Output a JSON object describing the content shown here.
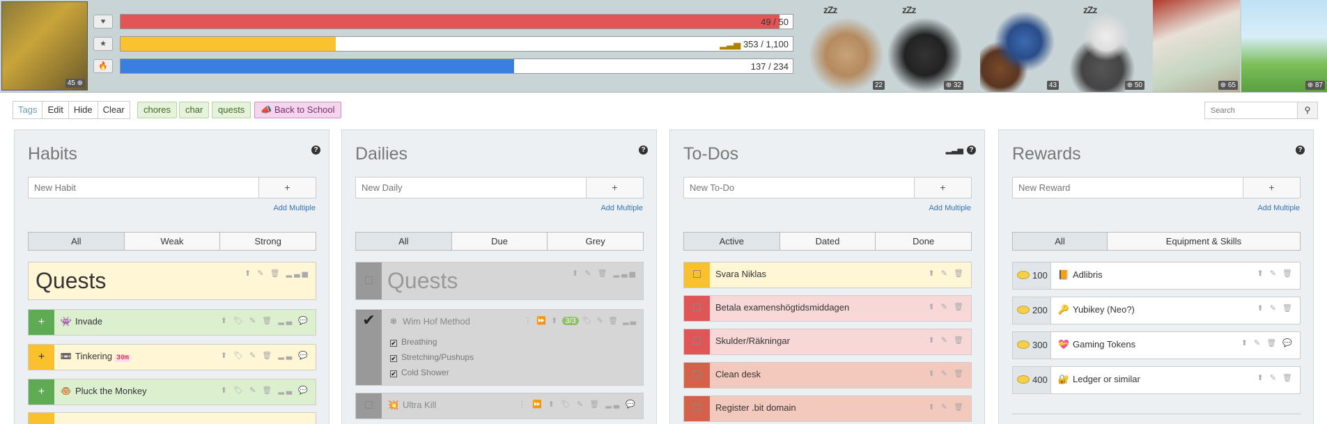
{
  "header": {
    "avatar_level": "45",
    "health": {
      "text": "49 / 50",
      "fraction": 0.98,
      "color": "#e05555"
    },
    "experience": {
      "text": "353 / 1,100",
      "fraction": 0.32,
      "color": "#f9c22e"
    },
    "mana": {
      "text": "137 / 234",
      "fraction": 0.585,
      "color": "#3a7fe0"
    },
    "party": [
      {
        "level": "22"
      },
      {
        "level": "32"
      },
      {
        "level": "43"
      },
      {
        "level": "50"
      },
      {
        "level": "65"
      },
      {
        "level": "87"
      }
    ],
    "sleep_glyph": "zZz"
  },
  "toolbar": {
    "tags": "Tags",
    "edit": "Edit",
    "hide": "Hide",
    "clear": "Clear",
    "tag_items": [
      "chores",
      "char",
      "quests"
    ],
    "back_to_school": "Back to School",
    "search_placeholder": "Search"
  },
  "common": {
    "add_multiple": "Add Multiple",
    "plus": "+",
    "help": "?"
  },
  "habits": {
    "title": "Habits",
    "placeholder": "New Habit",
    "filters": [
      "All",
      "Weak",
      "Strong"
    ],
    "header_task": "Quests",
    "items": [
      {
        "text": "Invade",
        "icon": "alien-icon"
      },
      {
        "text": "Tinkering",
        "icon": "videotape-icon",
        "badge": "30m"
      },
      {
        "text": "Pluck the Monkey",
        "icon": "monkey-icon"
      }
    ]
  },
  "dailies": {
    "title": "Dailies",
    "placeholder": "New Daily",
    "filters": [
      "All",
      "Due",
      "Grey"
    ],
    "header_task": "Quests",
    "wim": {
      "text": "Wim Hof Method",
      "progress": "3/3",
      "check": "✔",
      "checklist": [
        "Breathing",
        "Stretching/Pushups",
        "Cold Shower"
      ]
    },
    "ultra": {
      "text": "Ultra Kill"
    }
  },
  "todos": {
    "title": "To-Dos",
    "placeholder": "New To-Do",
    "filters": [
      "Active",
      "Dated",
      "Done"
    ],
    "items": [
      {
        "text": "Svara Niklas",
        "color": "#fbc02d",
        "bg": "#fff6d6"
      },
      {
        "text": "Betala examenshögtidsmiddagen",
        "color": "#e05555",
        "bg": "#f8d7d7"
      },
      {
        "text": "Skulder/Räkningar",
        "color": "#e05555",
        "bg": "#f8d7d7"
      },
      {
        "text": "Clean desk",
        "color": "#d4624a",
        "bg": "#f3c9bd"
      },
      {
        "text": "Register .bit domain",
        "color": "#d4624a",
        "bg": "#f3c9bd"
      }
    ]
  },
  "rewards": {
    "title": "Rewards",
    "placeholder": "New Reward",
    "filters": [
      "All",
      "Equipment & Skills"
    ],
    "items": [
      {
        "price": "100",
        "text": "Adlibris",
        "icon": "book-icon"
      },
      {
        "price": "200",
        "text": "Yubikey (Neo?)",
        "icon": "key-icon"
      },
      {
        "price": "300",
        "text": "Gaming Tokens",
        "icon": "gift-heart-icon"
      },
      {
        "price": "400",
        "text": "Ledger or similar",
        "icon": "locked-key-icon"
      }
    ]
  }
}
